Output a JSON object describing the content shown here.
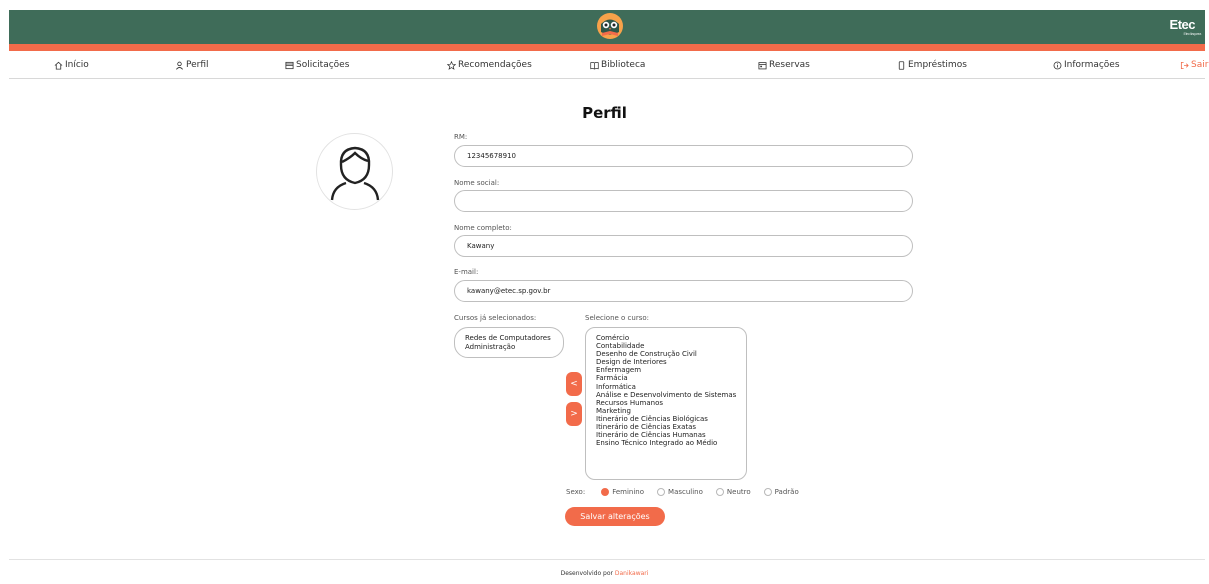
{
  "header": {
    "logo_icon": "owl-book-icon",
    "brand_text": "Etec",
    "brand_subtext": "Etec Itaquera",
    "colors": {
      "primary": "#3f6c59",
      "accent": "#f26b4a"
    }
  },
  "nav": {
    "items": [
      {
        "label": "Início",
        "icon": "home-icon"
      },
      {
        "label": "Perfil",
        "icon": "user-icon"
      },
      {
        "label": "Solicitações",
        "icon": "inbox-icon"
      },
      {
        "label": "Recomendações",
        "icon": "star-icon"
      },
      {
        "label": "Biblioteca",
        "icon": "book-icon"
      },
      {
        "label": "Reservas",
        "icon": "calendar-icon"
      },
      {
        "label": "Empréstimos",
        "icon": "book-bookmark-icon"
      },
      {
        "label": "Informações",
        "icon": "info-icon"
      },
      {
        "label": "Sair",
        "icon": "logout-icon"
      }
    ]
  },
  "profile": {
    "title": "Perfil",
    "rm_label": "RM:",
    "rm_value": "12345678910",
    "social_name_label": "Nome social:",
    "social_name_value": "",
    "full_name_label": "Nome completo:",
    "full_name_value": "Kawany",
    "email_label": "E-mail:",
    "email_value": "kawany@etec.sp.gov.br",
    "selected_courses_label": "Cursos já selecionados:",
    "selected_courses": [
      "Redes de Computadores",
      "Administração"
    ],
    "course_select_label": "Selecione o curso:",
    "courses": [
      "Comércio",
      "Contabilidade",
      "Desenho de Construção Civil",
      "Design de Interiores",
      "Enfermagem",
      "Farmácia",
      "Informática",
      "Análise e Desenvolvimento de Sistemas",
      "Recursos Humanos",
      "Marketing",
      "Itinerário de Ciências Biológicas",
      "Itinerário de Ciências Exatas",
      "Itinerário de Ciências Humanas",
      "Ensino Técnico Integrado ao Médio"
    ],
    "move_left": "<",
    "move_right": ">",
    "sex_label": "Sexo:",
    "sex_options": [
      "Feminino",
      "Masculino",
      "Neutro",
      "Padrão"
    ],
    "sex_selected": "Feminino",
    "save_label": "Salvar alterações"
  },
  "footer": {
    "prefix": "Desenvolvido por ",
    "developer": "Danikawari"
  }
}
